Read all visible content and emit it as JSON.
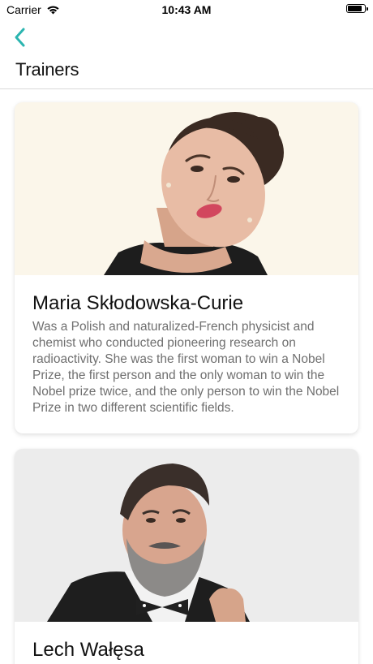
{
  "status_bar": {
    "carrier": "Carrier",
    "time": "10:43 AM",
    "battery_level": 0.9
  },
  "nav": {
    "back_icon": "chevron-left-icon",
    "title": "Trainers",
    "accent_color": "#2bb5b0"
  },
  "trainers": [
    {
      "name": "Maria Skłodowska-Curie",
      "bio": "Was a Polish and naturalized-French physicist and chemist who conducted pioneering research on radioactivity. She was the first woman to win a Nobel Prize, the first person and the only woman to win the Nobel prize twice, and the only person to win the Nobel Prize in two different scientific fields."
    },
    {
      "name": "Lech Wałęsa"
    }
  ]
}
